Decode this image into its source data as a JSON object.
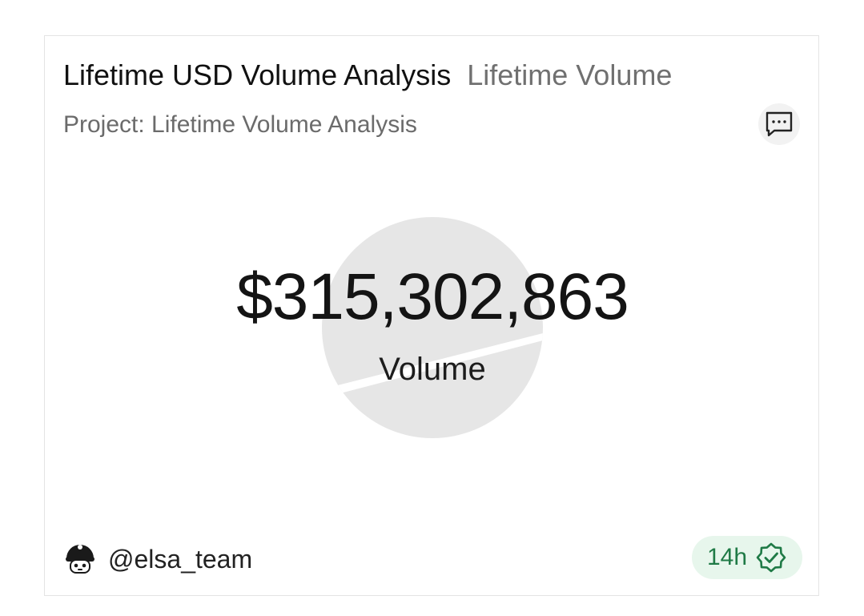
{
  "card": {
    "title": "Lifetime USD Volume Analysis",
    "subtitle": "Lifetime Volume",
    "project": "Project: Lifetime Volume Analysis",
    "metric": {
      "value": "$315,302,863",
      "label": "Volume"
    },
    "author": {
      "handle": "@elsa_team",
      "avatar_icon": "robot-avatar-icon"
    },
    "age": {
      "text": "14h",
      "icon": "verified-badge-icon"
    },
    "comment_icon": "comment-icon",
    "colors": {
      "badge_bg": "#e7f6ec",
      "badge_text": "#1f7a46",
      "watermark": "#e6e6e6"
    }
  }
}
